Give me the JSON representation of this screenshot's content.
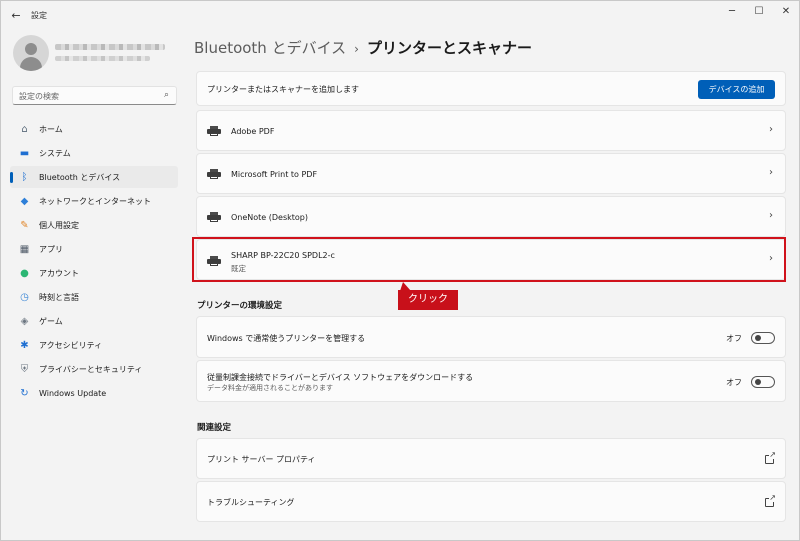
{
  "window": {
    "app_title": "設定",
    "back_glyph": "←",
    "minimize_glyph": "─",
    "maximize_glyph": "☐",
    "close_glyph": "✕"
  },
  "sidebar": {
    "search_placeholder": "設定の検索",
    "search_icon": "⌕",
    "items": [
      {
        "label": "ホーム",
        "icon": "home-icon",
        "glyph": "⌂",
        "color": "#5b6b7b",
        "selected": false
      },
      {
        "label": "システム",
        "icon": "display-icon",
        "glyph": "▬",
        "color": "#1f6fd1",
        "selected": false
      },
      {
        "label": "Bluetooth とデバイス",
        "icon": "bluetooth-icon",
        "glyph": "ᛒ",
        "color": "#1f6fd1",
        "selected": true
      },
      {
        "label": "ネットワークとインターネット",
        "icon": "wifi-icon",
        "glyph": "◆",
        "color": "#2d7fd8",
        "selected": false
      },
      {
        "label": "個人用設定",
        "icon": "brush-icon",
        "glyph": "✎",
        "color": "#e0862a",
        "selected": false
      },
      {
        "label": "アプリ",
        "icon": "apps-icon",
        "glyph": "▦",
        "color": "#4d5866",
        "selected": false
      },
      {
        "label": "アカウント",
        "icon": "account-icon",
        "glyph": "●",
        "color": "#2bb673",
        "selected": false
      },
      {
        "label": "時刻と言語",
        "icon": "clock-globe-icon",
        "glyph": "◷",
        "color": "#3a86d6",
        "selected": false
      },
      {
        "label": "ゲーム",
        "icon": "gamepad-icon",
        "glyph": "◈",
        "color": "#6b7580",
        "selected": false
      },
      {
        "label": "アクセシビリティ",
        "icon": "accessibility-icon",
        "glyph": "✱",
        "color": "#1f6fd1",
        "selected": false
      },
      {
        "label": "プライバシーとセキュリティ",
        "icon": "shield-icon",
        "glyph": "⛨",
        "color": "#6b7580",
        "selected": false
      },
      {
        "label": "Windows Update",
        "icon": "update-icon",
        "glyph": "↻",
        "color": "#1f6fd1",
        "selected": false
      }
    ]
  },
  "header": {
    "breadcrumb_parent": "Bluetooth とデバイス",
    "separator": "›",
    "current": "プリンターとスキャナー"
  },
  "add_printer": {
    "label": "プリンターまたはスキャナーを追加します",
    "button": "デバイスの追加"
  },
  "printers": [
    {
      "name": "Adobe PDF",
      "sub": ""
    },
    {
      "name": "Microsoft Print to PDF",
      "sub": ""
    },
    {
      "name": "OneNote (Desktop)",
      "sub": ""
    },
    {
      "name": "SHARP BP-22C20 SPDL2-c",
      "sub": "既定"
    }
  ],
  "chevron": "›",
  "annotation": {
    "callout": "クリック",
    "highlight_color": "#d0121b"
  },
  "printer_prefs": {
    "title": "プリンターの環境設定",
    "manage_default": {
      "label": "Windows で通常使うプリンターを管理する",
      "state": "オフ",
      "on": false
    },
    "metered": {
      "label": "従量制課金接続でドライバーとデバイス ソフトウェアをダウンロードする",
      "sub": "データ料金が適用されることがあります",
      "state": "オフ",
      "on": false
    }
  },
  "related": {
    "title": "関連設定",
    "items": [
      {
        "label": "プリント サーバー プロパティ",
        "icon": "external-link-icon"
      },
      {
        "label": "トラブルシューティング",
        "icon": "external-link-icon"
      }
    ]
  },
  "colors": {
    "accent": "#005fb8",
    "annotation_red": "#c8101a"
  }
}
